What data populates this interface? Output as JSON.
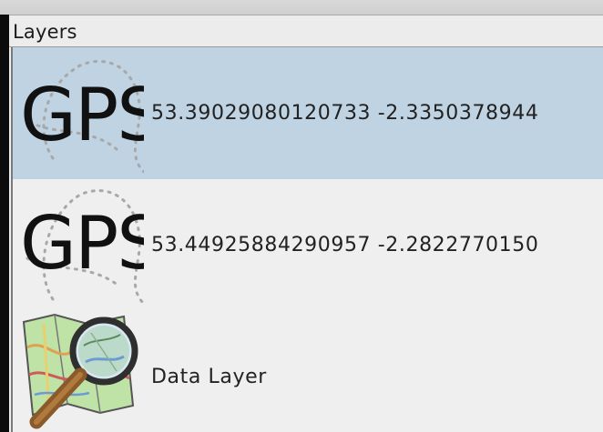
{
  "panel": {
    "title": "Layers"
  },
  "layers": [
    {
      "icon": "gps-icon",
      "icon_text": "GPS",
      "label": "53.39029080120733 -2.3350378944",
      "selected": true
    },
    {
      "icon": "gps-icon",
      "icon_text": "GPS",
      "label": "53.44925884290957 -2.2822770150",
      "selected": false
    },
    {
      "icon": "map-magnifier-icon",
      "label": "Data Layer",
      "selected": false
    }
  ],
  "colors": {
    "selection": "#bfd3e2",
    "background": "#efefef",
    "map_green": "#a8d08d",
    "magnifier_handle": "#8b5a2b"
  }
}
